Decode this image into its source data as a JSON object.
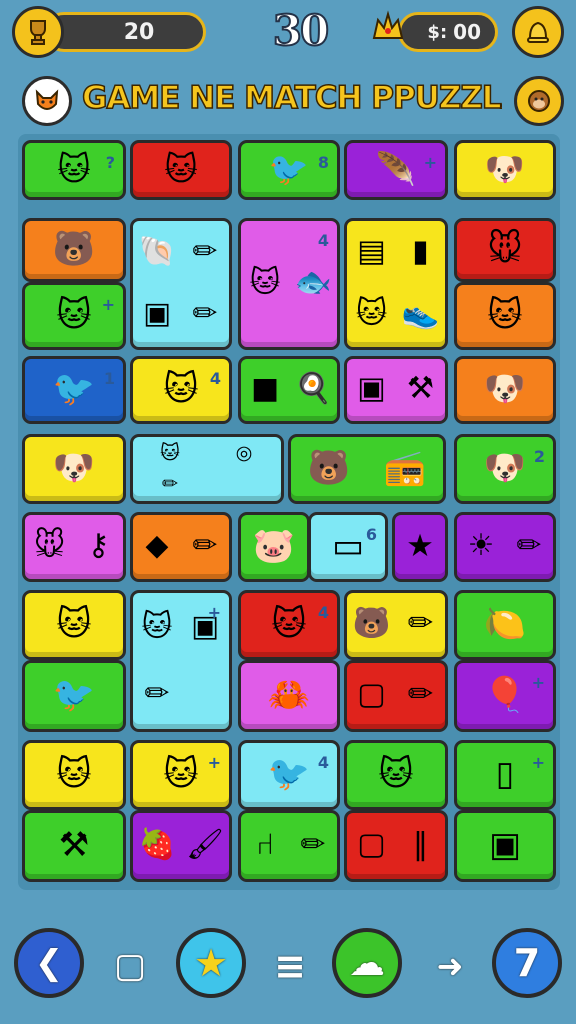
{
  "hud": {
    "score": "20",
    "moves": "30",
    "timer_prefix": "$:",
    "timer": "00"
  },
  "title": "GAME NE MATCH PPUZZLA",
  "colors": {
    "background": "#5a9ec0",
    "green": "#3ecf2a",
    "red": "#e0231c",
    "purple": "#9a22d8",
    "yellow": "#f7e51c",
    "orange": "#f5801c",
    "cyan": "#7fe8f5",
    "magenta": "#e05ce8",
    "blue": "#1f63c9",
    "gold": "#f4c21c"
  },
  "tiles": [
    {
      "id": "r1c1",
      "color": "green",
      "icons": [
        "cat-icon"
      ],
      "badge": "?"
    },
    {
      "id": "r1c2",
      "color": "red",
      "icons": [
        "cat-icon"
      ],
      "badge": ""
    },
    {
      "id": "r1c3",
      "color": "green",
      "icons": [
        "bird-icon"
      ],
      "badge": "8"
    },
    {
      "id": "r1c4",
      "color": "purple",
      "icons": [
        "feather-icon"
      ],
      "badge": "+"
    },
    {
      "id": "r1c5",
      "color": "yellow",
      "icons": [
        "dog-icon"
      ],
      "badge": ""
    },
    {
      "id": "r2c1",
      "color": "orange",
      "icons": [
        "bear-icon"
      ],
      "badge": ""
    },
    {
      "id": "r2c1b",
      "color": "green",
      "icons": [
        "cat-icon"
      ],
      "badge": "+"
    },
    {
      "id": "r2c2",
      "color": "cyan",
      "icons": [
        "shell-icon",
        "pencil-icon",
        "box-icon",
        "pencil-icon"
      ],
      "badge": ""
    },
    {
      "id": "r2c3",
      "color": "magenta",
      "icons": [
        "cat-icon",
        "fish-icon"
      ],
      "badge": "4"
    },
    {
      "id": "r2c4",
      "color": "yellow",
      "icons": [
        "book-icon",
        "bottle-icon",
        "cat-icon",
        "shoe-icon"
      ],
      "badge": ""
    },
    {
      "id": "r2c5",
      "color": "red",
      "icons": [
        "mouse-icon"
      ],
      "badge": ""
    },
    {
      "id": "r2c5b",
      "color": "orange",
      "icons": [
        "cat-icon"
      ],
      "badge": ""
    },
    {
      "id": "r3c1",
      "color": "blue",
      "icons": [
        "bird-icon"
      ],
      "badge": "1"
    },
    {
      "id": "r3c2",
      "color": "yellow",
      "icons": [
        "cat-icon"
      ],
      "badge": "4"
    },
    {
      "id": "r3c3",
      "color": "green",
      "icons": [
        "cube-icon",
        "pan-icon"
      ],
      "badge": ""
    },
    {
      "id": "r3c4",
      "color": "magenta",
      "icons": [
        "box-icon",
        "tool-icon"
      ],
      "badge": ""
    },
    {
      "id": "r3c5",
      "color": "orange",
      "icons": [
        "dog-icon"
      ],
      "badge": ""
    },
    {
      "id": "r4c1",
      "color": "yellow",
      "icons": [
        "dog-icon"
      ],
      "badge": ""
    },
    {
      "id": "r4c2",
      "color": "cyan",
      "icons": [
        "cat-icon",
        "ring-icon",
        "pencil-icon"
      ],
      "badge": ""
    },
    {
      "id": "r4c3",
      "color": "green",
      "icons": [
        "bear-icon",
        "radio-icon"
      ],
      "badge": ""
    },
    {
      "id": "r4c5",
      "color": "green",
      "icons": [
        "dog-icon"
      ],
      "badge": "2"
    },
    {
      "id": "r5c1",
      "color": "magenta",
      "icons": [
        "mouse-icon",
        "key-icon"
      ],
      "badge": ""
    },
    {
      "id": "r5c2",
      "color": "orange",
      "icons": [
        "gem-icon",
        "pencil-icon"
      ],
      "badge": ""
    },
    {
      "id": "r5c3",
      "color": "green",
      "icons": [
        "pig-icon"
      ],
      "badge": ""
    },
    {
      "id": "r5c3b",
      "color": "cyan",
      "icons": [
        "card-icon"
      ],
      "badge": "6"
    },
    {
      "id": "r5c4",
      "color": "purple",
      "icons": [
        "star-icon"
      ],
      "badge": ""
    },
    {
      "id": "r5c5",
      "color": "purple",
      "icons": [
        "sun-icon",
        "pencil-icon"
      ],
      "badge": ""
    },
    {
      "id": "r6c1",
      "color": "yellow",
      "icons": [
        "cat-icon"
      ],
      "badge": ""
    },
    {
      "id": "r6c1b",
      "color": "green",
      "icons": [
        "bird-icon"
      ],
      "badge": ""
    },
    {
      "id": "r6c2",
      "color": "cyan",
      "icons": [
        "cat-icon",
        "box-icon",
        "pencil-icon"
      ],
      "badge": "+"
    },
    {
      "id": "r6c3",
      "color": "red",
      "icons": [
        "cat-icon"
      ],
      "badge": "4"
    },
    {
      "id": "r6c3b",
      "color": "magenta",
      "icons": [
        "crab-icon"
      ],
      "badge": ""
    },
    {
      "id": "r6c4",
      "color": "yellow",
      "icons": [
        "bear-icon",
        "pencil-icon"
      ],
      "badge": ""
    },
    {
      "id": "r6c4b",
      "color": "red",
      "icons": [
        "frame-icon",
        "pencil-icon"
      ],
      "badge": ""
    },
    {
      "id": "r6c5",
      "color": "green",
      "icons": [
        "lemon-icon"
      ],
      "badge": ""
    },
    {
      "id": "r6c5b",
      "color": "purple",
      "icons": [
        "balloon-icon"
      ],
      "badge": "+"
    },
    {
      "id": "r7c1",
      "color": "yellow",
      "icons": [
        "cat-icon"
      ],
      "badge": ""
    },
    {
      "id": "r7c1b",
      "color": "green",
      "icons": [
        "tool-icon"
      ],
      "badge": ""
    },
    {
      "id": "r7c2",
      "color": "yellow",
      "icons": [
        "cat-icon"
      ],
      "badge": "+"
    },
    {
      "id": "r7c2b",
      "color": "purple",
      "icons": [
        "fruit-icon",
        "brush-icon"
      ],
      "badge": ""
    },
    {
      "id": "r7c3",
      "color": "cyan",
      "icons": [
        "bird-icon"
      ],
      "badge": "4"
    },
    {
      "id": "r7c3b",
      "color": "green",
      "icons": [
        "chair-icon",
        "pencil-icon"
      ],
      "badge": ""
    },
    {
      "id": "r7c4",
      "color": "green",
      "icons": [
        "cat-icon"
      ],
      "badge": ""
    },
    {
      "id": "r7c4b",
      "color": "red",
      "icons": [
        "frame-icon",
        "comb-icon"
      ],
      "badge": ""
    },
    {
      "id": "r7c5",
      "color": "green",
      "icons": [
        "phone-icon"
      ],
      "badge": "+"
    },
    {
      "id": "r7c5b",
      "color": "green",
      "icons": [
        "box-icon"
      ],
      "badge": ""
    }
  ],
  "bottom_bar": [
    {
      "name": "back-button",
      "icon": "chevron-left-icon",
      "glyph": "❮"
    },
    {
      "name": "cards-button",
      "icon": "square-icon",
      "glyph": "▢"
    },
    {
      "name": "star-button",
      "icon": "star-icon",
      "glyph": "★"
    },
    {
      "name": "menu-button",
      "icon": "menu-icon",
      "glyph": "≡"
    },
    {
      "name": "cloud-button",
      "icon": "cloud-icon",
      "glyph": "☁"
    },
    {
      "name": "forward-button",
      "icon": "arrow-right-icon",
      "glyph": "➜"
    },
    {
      "name": "level-button",
      "icon": "number-icon",
      "glyph": "7"
    }
  ]
}
